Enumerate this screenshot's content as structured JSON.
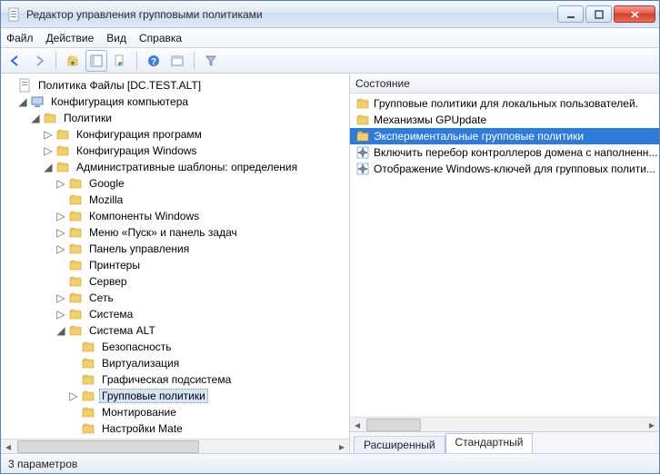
{
  "window": {
    "title": "Редактор управления групповыми политиками"
  },
  "menu": {
    "file": "Файл",
    "action": "Действие",
    "view": "Вид",
    "help": "Справка"
  },
  "tree": {
    "root": "Политика Файлы [DC.TEST.ALT]",
    "computer_config": "Конфигурация компьютера",
    "policies": "Политики",
    "software_config": "Конфигурация программ",
    "windows_config": "Конфигурация Windows",
    "admin_templates": "Административные шаблоны: определения",
    "google": "Google",
    "mozilla": "Mozilla",
    "windows_components": "Компоненты Windows",
    "start_menu": "Меню «Пуск» и панель задач",
    "control_panel": "Панель управления",
    "printers": "Принтеры",
    "server": "Сервер",
    "network": "Сеть",
    "system": "Система",
    "system_alt": "Система ALT",
    "security": "Безопасность",
    "virtualization": "Виртуализация",
    "graphics_subsystem": "Графическая подсистема",
    "group_policies": "Групповые политики",
    "mounting": "Монтирование",
    "mate_settings": "Настройки Mate"
  },
  "list": {
    "header": "Состояние",
    "items": [
      {
        "label": "Групповые политики для локальных пользователей.",
        "type": "folder"
      },
      {
        "label": "Механизмы GPUpdate",
        "type": "folder"
      },
      {
        "label": "Экспериментальные групповые политики",
        "type": "folder",
        "selected": true
      },
      {
        "label": "Включить перебор контроллеров домена с наполненн...",
        "type": "setting"
      },
      {
        "label": "Отображение Windows-ключей для групповых полити...",
        "type": "setting"
      }
    ]
  },
  "tabs": {
    "extended": "Расширенный",
    "standard": "Стандартный"
  },
  "statusbar": {
    "text": "3 параметров"
  }
}
